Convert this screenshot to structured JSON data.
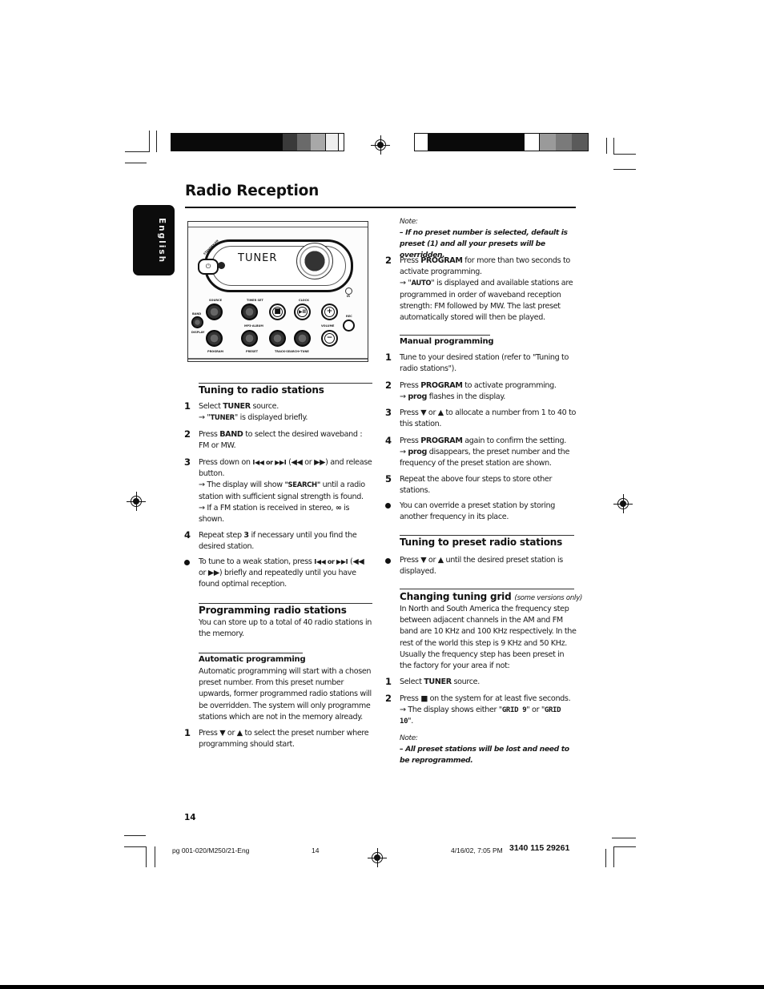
{
  "page": {
    "title": "Radio Reception",
    "language_tab": "English",
    "page_number": "14"
  },
  "illustration": {
    "display_text": "TUNER",
    "labels": {
      "standby": "STANDBY-ON",
      "source": "SOURCE",
      "timer_set": "TIMER SET",
      "clock": "CLOCK",
      "band": "BAND",
      "display": "DISPLAY",
      "mp3_album": "MP3-ALBUM",
      "volume": "VOLUME",
      "rec": "REC",
      "program": "PROGRAM",
      "preset": "PRESET",
      "track_search_tune": "TRACK-SEARCH•TUNE",
      "ir": "IR"
    },
    "button_glyphs": {
      "stop": "■",
      "play_pause": "▶II",
      "vol_up": "+",
      "vol_down": "−"
    }
  },
  "left_column": {
    "tuning": {
      "heading": "Tuning to radio stations",
      "step1_num": "1",
      "step1_a": "Select ",
      "step1_b": "TUNER",
      "step1_c": " source.",
      "step1_arrow": "→ \"",
      "step1_d": "TUNER",
      "step1_e": "\" is displayed briefly.",
      "step2_num": "2",
      "step2_a": "Press ",
      "step2_b": "BAND",
      "step2_c": " to select the desired waveband : FM or MW.",
      "step3_num": "3",
      "step3_a": "Press down on ",
      "step3_icons": "I◀◀ or ▶▶I",
      "step3_b": " (◀◀ or ▶▶) and release button.",
      "step3_c": "→ The display will show ",
      "step3_d": "\"SEARCH\"",
      "step3_e": " until a radio station with sufficient signal strength is found.",
      "step3_f": "→ If a FM station is received in stereo, ",
      "step3_g": "∞",
      "step3_h": " is shown.",
      "step4_num": "4",
      "step4_a": "Repeat step ",
      "step4_b": "3",
      "step4_c": " if necessary until you find the desired station.",
      "bullet_a": "To tune to a weak station, press ",
      "bullet_icons": "I◀◀ or ▶▶I",
      "bullet_b": " (◀◀ or ▶▶) briefly and repeatedly until you have found optimal reception."
    },
    "programming": {
      "heading": "Programming radio stations",
      "intro": "You can store up to a total of 40 radio stations in the memory."
    },
    "automatic": {
      "heading": "Automatic programming",
      "body": "Automatic programming will start with a chosen preset number. From this preset number upwards, former programmed radio stations will be overridden. The system will only programme stations which are not in the memory already.",
      "step1_num": "1",
      "step1_a": "Press ▼ or ▲ to select the preset number where programming should start."
    }
  },
  "right_column": {
    "note1_label": "Note:",
    "note1_text": "– If no preset number is selected, default is preset (1) and all your presets will be overridden.",
    "auto_step2_num": "2",
    "auto_step2_a": "Press ",
    "auto_step2_b": "PROGRAM",
    "auto_step2_c": " for more than two seconds to activate programming.",
    "auto_step2_d": "→ \"",
    "auto_step2_e": "AUTO",
    "auto_step2_f": "\" is displayed and available stations are programmed in order of waveband reception strength: FM followed by MW. The last preset automatically stored will then be played.",
    "manual": {
      "heading": "Manual programming",
      "s1_num": "1",
      "s1": "Tune to your desired station (refer to \"Tuning to radio stations\").",
      "s2_num": "2",
      "s2_a": "Press ",
      "s2_b": "PROGRAM",
      "s2_c": " to activate programming.",
      "s2_d": "→ ",
      "s2_e": "prog",
      "s2_f": " flashes in the display.",
      "s3_num": "3",
      "s3": "Press ▼ or ▲ to allocate a number from 1 to 40 to this station.",
      "s4_num": "4",
      "s4_a": "Press ",
      "s4_b": "PROGRAM",
      "s4_c": " again to confirm the setting.",
      "s4_d": "→ ",
      "s4_e": "prog",
      "s4_f": " disappears, the preset number and the frequency of the preset station are shown.",
      "s5_num": "5",
      "s5": "Repeat the above four steps to store other stations.",
      "bullet": "You can override a preset station by storing another frequency in its place."
    },
    "preset": {
      "heading": "Tuning to preset radio stations",
      "bullet": "Press ▼ or ▲ until the desired preset station is displayed."
    },
    "grid": {
      "heading": "Changing tuning grid",
      "heading_note": "(some versions only)",
      "body": "In North and South America the frequency step between adjacent channels in the AM and FM band are 10 KHz and 100 KHz respectively. In the rest of the world this step is 9 KHz and 50 KHz. Usually the frequency step has been preset in the factory for your area if not:",
      "s1_num": "1",
      "s1_a": "Select ",
      "s1_b": "TUNER",
      "s1_c": " source.",
      "s2_num": "2",
      "s2_a": "Press ■ on the system for at least five seconds.",
      "s2_b": "→ The display shows either \"",
      "s2_c": "GRID 9",
      "s2_d": "\" or \"",
      "s2_e": "GRID 10",
      "s2_f": "\".",
      "note_label": "Note:",
      "note_text": "– All preset stations will be lost and need to be reprogrammed."
    }
  },
  "footer": {
    "file": "pg 001-020/M250/21-Eng",
    "page": "14",
    "datetime": "4/16/02, 7:05 PM",
    "code": "3140 115 29261"
  },
  "colors": {
    "ink": "#111111",
    "tab_bg": "#0c0c0c"
  }
}
